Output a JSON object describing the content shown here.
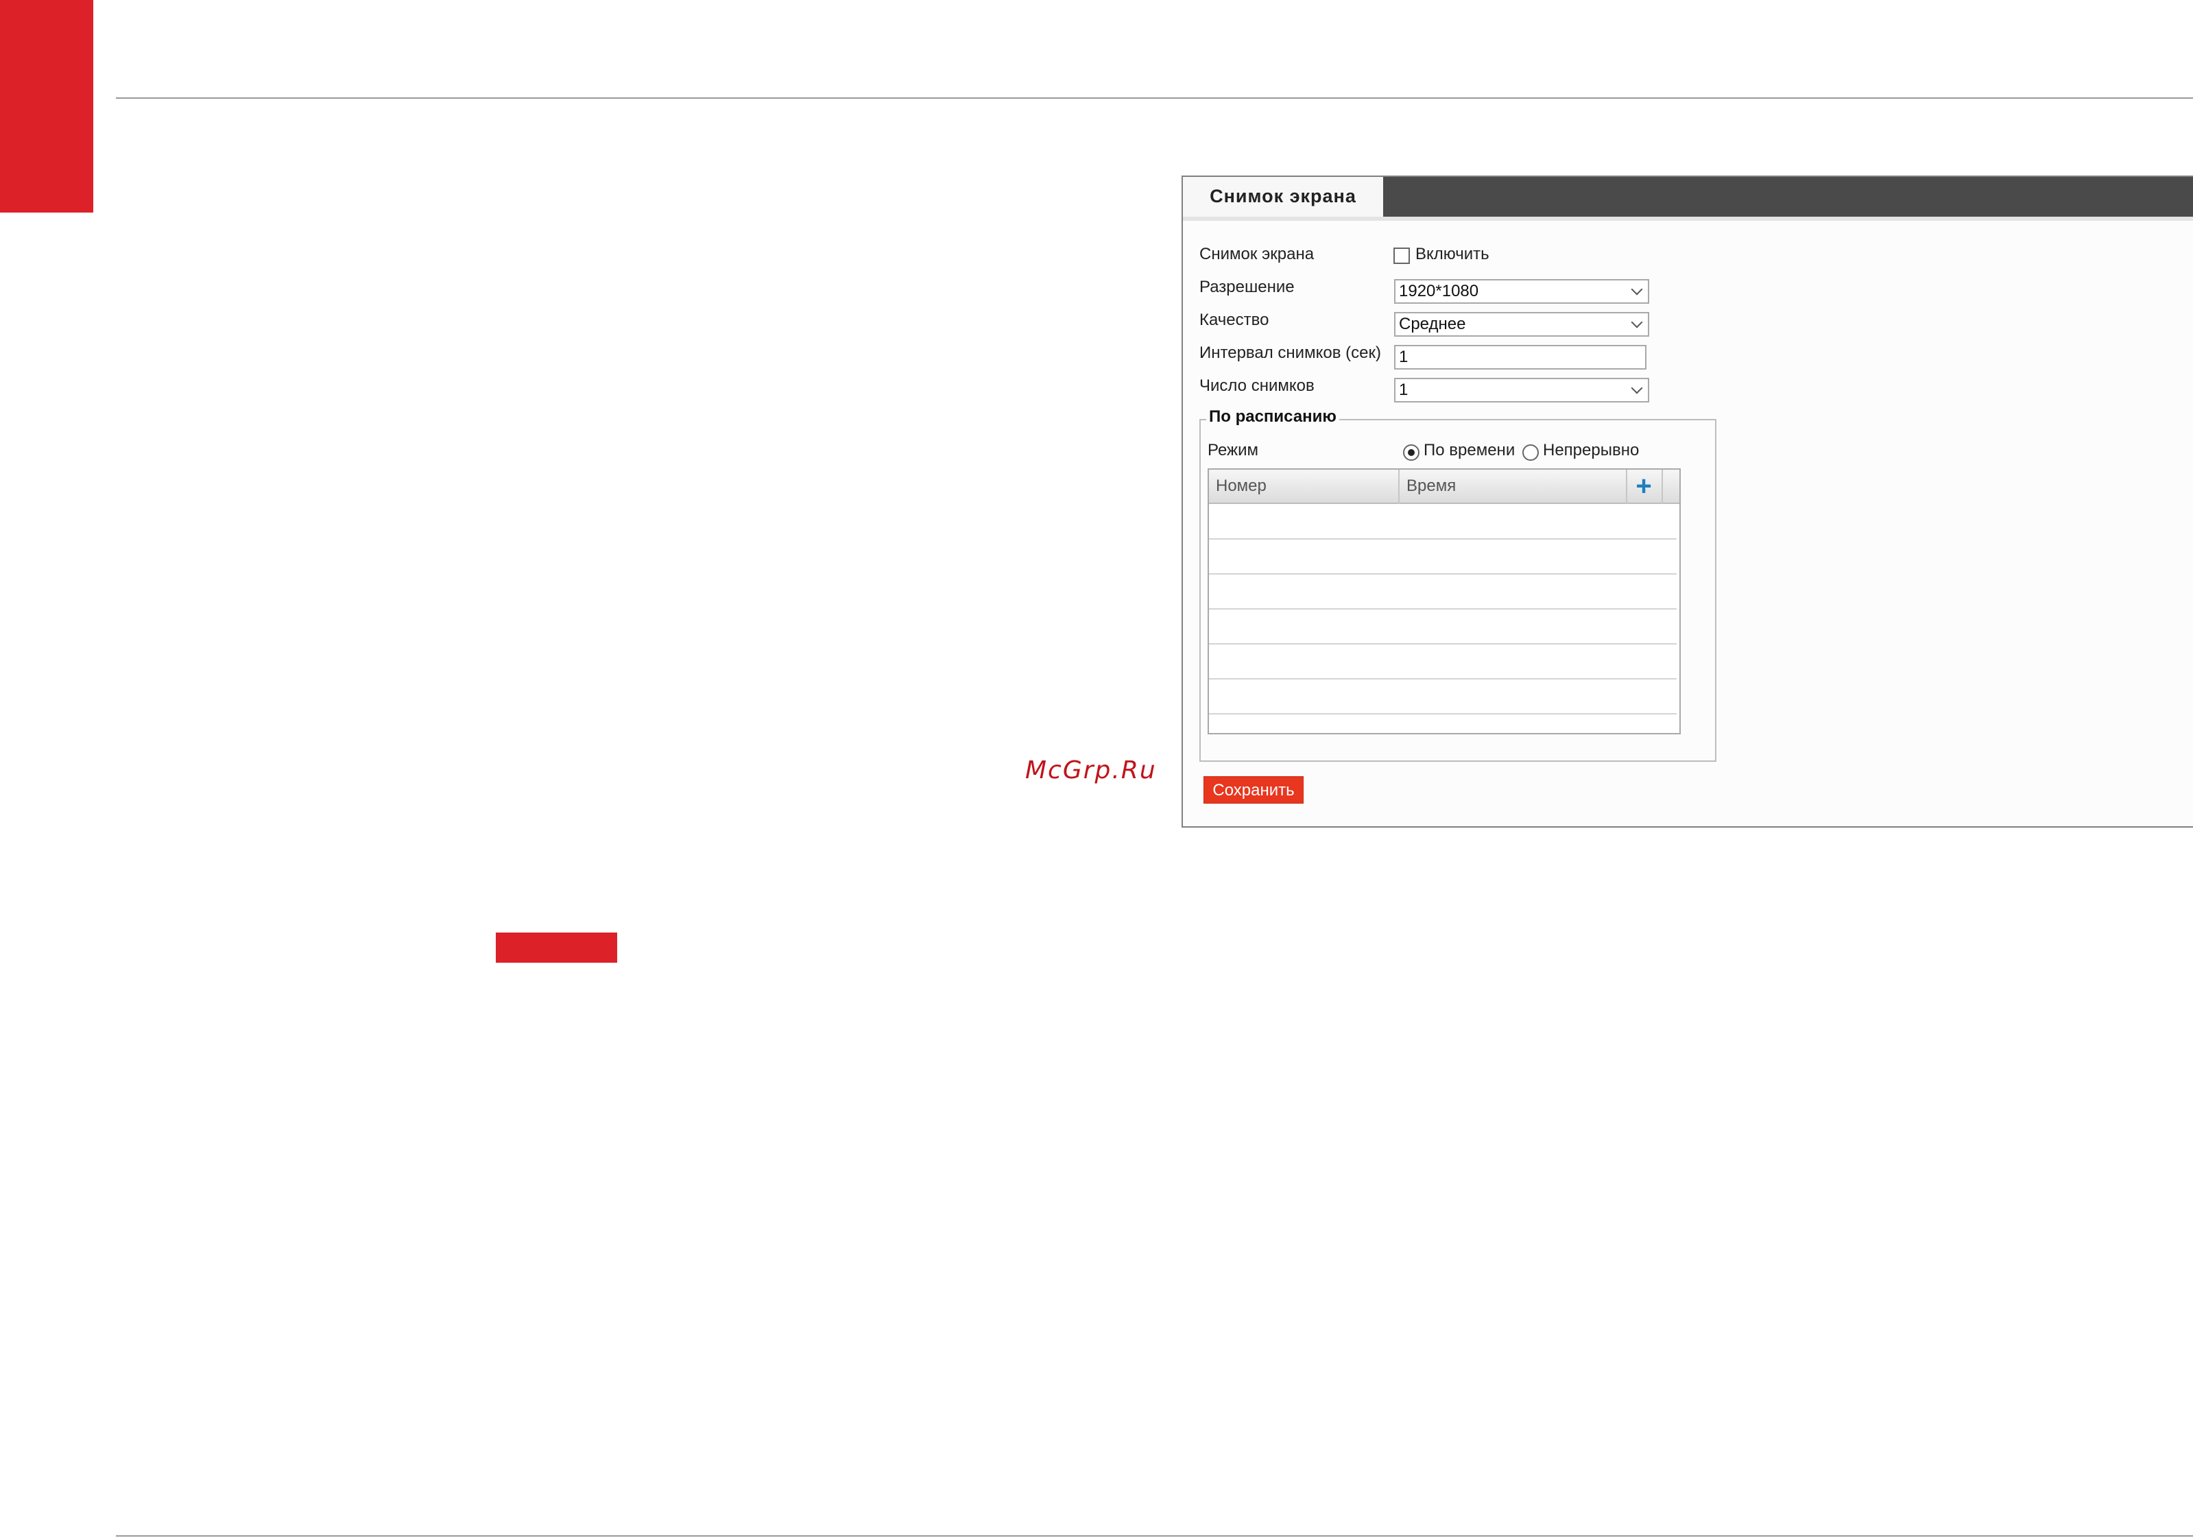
{
  "watermark": "McGrp.Ru",
  "panel": {
    "tab_label": "Снимок экрана",
    "fields": {
      "snapshot_label": "Снимок экрана",
      "enable_label": "Включить",
      "enable_checked": false,
      "resolution_label": "Разрешение",
      "resolution_value": "1920*1080",
      "quality_label": "Качество",
      "quality_value": "Среднее",
      "interval_label": "Интервал снимков (сек)",
      "interval_value": "1",
      "count_label": "Число снимков",
      "count_value": "1"
    },
    "schedule": {
      "legend": "По расписанию",
      "mode_label": "Режим",
      "mode_options": [
        "По времени",
        "Непрерывно"
      ],
      "mode_selected": "По времени",
      "table": {
        "columns": [
          "Номер",
          "Время"
        ],
        "rows": []
      }
    },
    "save_label": "Сохранить"
  },
  "colors": {
    "accent_red": "#dc2128",
    "save_button": "#e8361f",
    "tab_bar": "#4a4a4a",
    "add_icon": "#1d7fc0"
  }
}
